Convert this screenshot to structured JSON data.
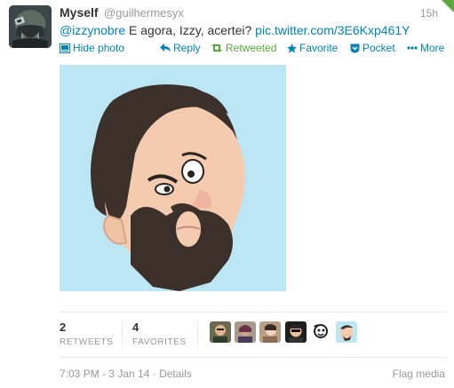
{
  "tweet": {
    "fullname": "Myself",
    "username": "@guilhermesyx",
    "timestamp": "15h",
    "text": {
      "mention": "@izzynobre",
      "body": " E agora, Izzy, acertei? ",
      "link": "pic.twitter.com/3E6Kxp461Y"
    },
    "actions": {
      "hide_photo": "Hide photo",
      "reply": "Reply",
      "retweeted": "Retweeted",
      "favorite": "Favorite",
      "pocket": "Pocket",
      "more": "More"
    },
    "stats": {
      "retweets_count": "2",
      "retweets_label": "RETWEETS",
      "favorites_count": "4",
      "favorites_label": "FAVORITES"
    },
    "footer": {
      "datetime": "7:03 PM - 3 Jan 14",
      "separator": " · ",
      "details": "Details",
      "flag_media": "Flag media"
    }
  },
  "colors": {
    "link": "#0084b4",
    "retweeted": "#5aa83d",
    "muted": "#999999",
    "media_background": "#bde6f5"
  },
  "icons": [
    "photo-icon",
    "reply-icon",
    "retweet-icon",
    "favorite-star-icon",
    "pocket-icon",
    "more-dots-icon"
  ]
}
